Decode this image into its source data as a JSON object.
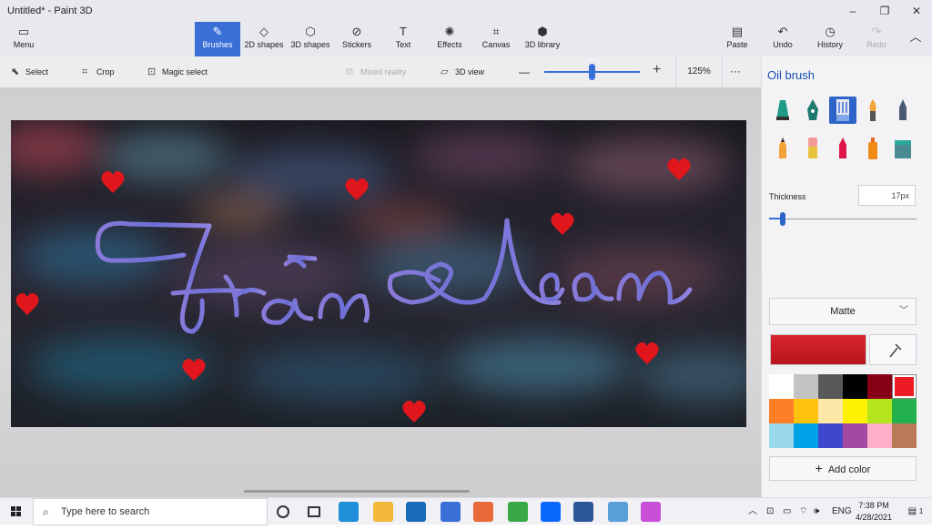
{
  "window": {
    "title": "Untitled* - Paint 3D",
    "minimize": "–",
    "maximize": "❐",
    "close": "✕"
  },
  "ribbon": {
    "menu": "Menu",
    "tabs": [
      {
        "label": "Brushes",
        "icon": "brush-icon",
        "glyph": "✎",
        "active": true
      },
      {
        "label": "2D shapes",
        "icon": "2d-shapes-icon",
        "glyph": "◇"
      },
      {
        "label": "3D shapes",
        "icon": "3d-shapes-icon",
        "glyph": "⬡"
      },
      {
        "label": "Stickers",
        "icon": "stickers-icon",
        "glyph": "⊘"
      },
      {
        "label": "Text",
        "icon": "text-icon",
        "glyph": "T"
      },
      {
        "label": "Effects",
        "icon": "effects-icon",
        "glyph": "✺"
      },
      {
        "label": "Canvas",
        "icon": "canvas-icon",
        "glyph": "⌗"
      },
      {
        "label": "3D library",
        "icon": "3d-library-icon",
        "glyph": "⬢"
      }
    ],
    "paste": "Paste",
    "undo": "Undo",
    "history": "History",
    "redo": "Redo"
  },
  "toolbar": {
    "select": "Select",
    "crop": "Crop",
    "magic_select": "Magic select",
    "mixed_reality": "Mixed reality",
    "view3d": "3D view",
    "zoom_minus": "—",
    "zoom_plus": "+",
    "zoom": "125%",
    "more": "···",
    "zoom_level": 0.5
  },
  "canvas": {
    "signature": "Trần Loan",
    "background": "blurred bokeh night scene",
    "stroke_color": "#7a73d8",
    "hearts_color": "#e0161c"
  },
  "panel": {
    "title": "Oil brush",
    "brushes": [
      "marker-icon",
      "calligraphy-pen-icon",
      "oil-brush-icon",
      "watercolor-icon",
      "pixel-pen-icon",
      "pencil-icon",
      "eraser-icon",
      "crayon-icon",
      "spray-can-icon",
      "fill-icon"
    ],
    "selected_brush": 2,
    "thickness_label": "Thickness",
    "thickness_value": "17px",
    "finish": "Matte",
    "current_color": "#d9232b",
    "palette": [
      "#ffffff",
      "#c3c3c3",
      "#585858",
      "#000000",
      "#880015",
      "#ed1c24",
      "#ff7f27",
      "#ffc20e",
      "#fde8a8",
      "#fff200",
      "#b5e61d",
      "#22b14c",
      "#99d9ea",
      "#00a2e8",
      "#3f48cc",
      "#a349a4",
      "#ffaec9",
      "#b97a57"
    ],
    "selected_swatch": 5,
    "add_color": "Add color"
  },
  "taskbar": {
    "search_placeholder": "Type here to search",
    "apps": [
      {
        "icon": "cortana-icon",
        "color": "#333333"
      },
      {
        "icon": "task-view-icon",
        "color": "#333333"
      },
      {
        "icon": "edge-icon",
        "color": "#1e8fd8"
      },
      {
        "icon": "file-explorer-icon",
        "color": "#f2b83a"
      },
      {
        "icon": "mail-icon",
        "color": "#1a6bb8"
      },
      {
        "icon": "photo-app-icon",
        "color": "#3a6fd8"
      },
      {
        "icon": "media-player-icon",
        "color": "#e86a3a"
      },
      {
        "icon": "green-app-icon",
        "color": "#3aa847"
      },
      {
        "icon": "zalo-icon",
        "color": "#0a68ff"
      },
      {
        "icon": "word-icon",
        "color": "#2b5797"
      },
      {
        "icon": "paint-icon",
        "color": "#5aa0d8"
      },
      {
        "icon": "paint3d-icon",
        "color": "#c84fd8"
      }
    ],
    "lang": "ENG",
    "time": "7:38 PM",
    "date": "4/28/2021",
    "notifications": "1"
  }
}
